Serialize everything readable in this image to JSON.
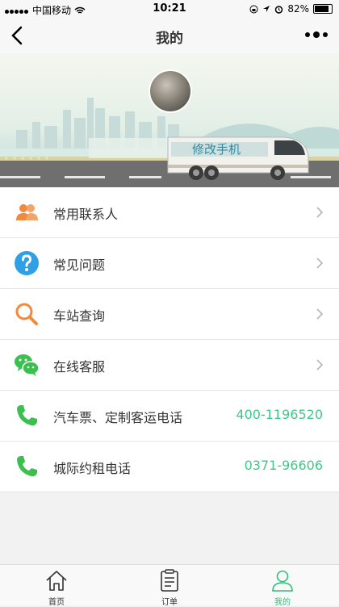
{
  "status": {
    "carrier": "中国移动",
    "time": "10:21",
    "battery": "82%"
  },
  "nav": {
    "title": "我的"
  },
  "banner": {
    "edit_phone": "修改手机"
  },
  "menu": [
    {
      "label": "常用联系人",
      "icon": "contacts-icon"
    },
    {
      "label": "常见问题",
      "icon": "question-icon"
    },
    {
      "label": "车站查询",
      "icon": "search-icon"
    },
    {
      "label": "在线客服",
      "icon": "wechat-chat-icon"
    }
  ],
  "phones": [
    {
      "label": "汽车票、定制客运电话",
      "number": "400-1196520",
      "icon": "phone-icon"
    },
    {
      "label": "城际约租电话",
      "number": "0371-96606",
      "icon": "phone-icon"
    }
  ],
  "tabs": [
    {
      "label": "首页",
      "icon": "home-icon"
    },
    {
      "label": "订单",
      "icon": "clipboard-icon"
    },
    {
      "label": "我的",
      "icon": "user-icon",
      "active": true
    }
  ],
  "colors": {
    "accent": "#2fbf7b",
    "phone": "#3fc98a",
    "orange": "#f08a3e",
    "blue": "#2f9fe6",
    "green": "#3bbf4f"
  }
}
